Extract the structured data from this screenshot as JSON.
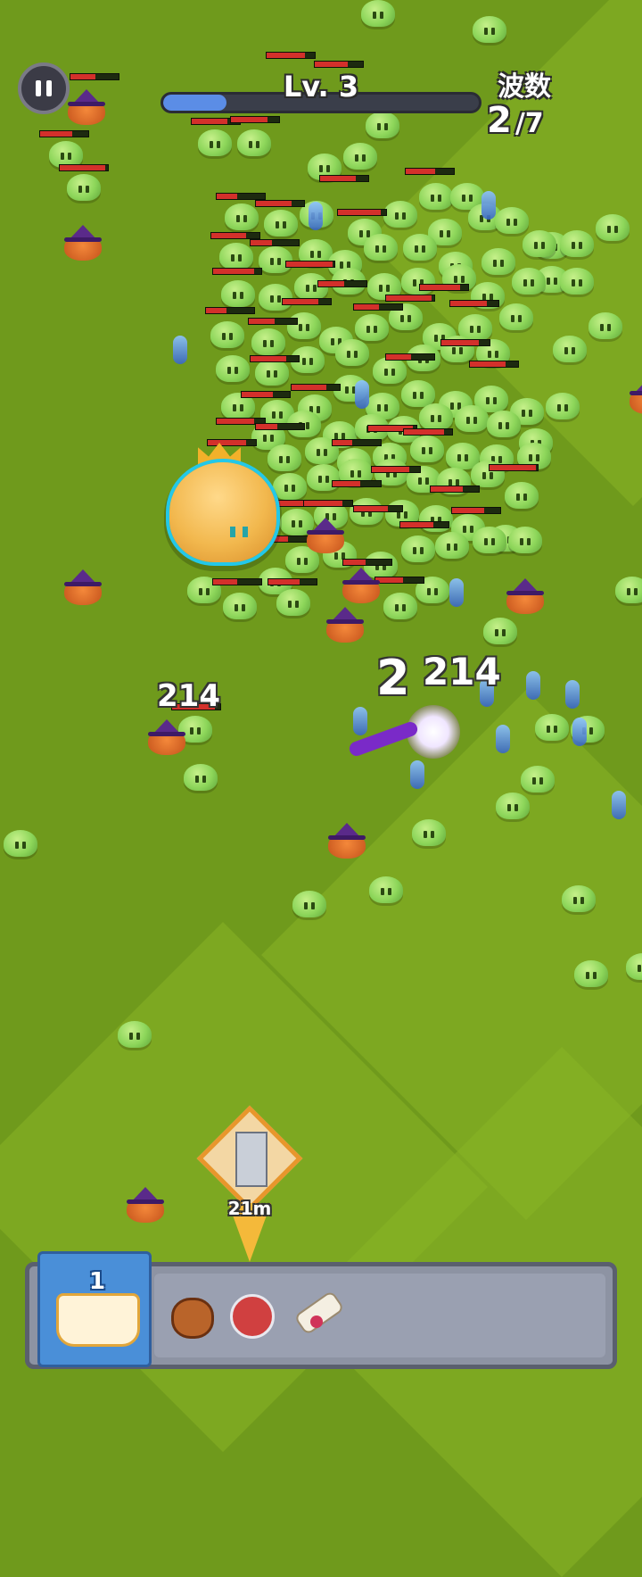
{
  "hud": {
    "pause_icon": "pause-icon",
    "level_label": "Lv. 3",
    "xp_progress": 0.2,
    "wave_label": "波数",
    "wave_current": "2",
    "wave_total": "/7"
  },
  "combat": {
    "damage_numbers": [
      "214",
      "2",
      "214"
    ]
  },
  "marker": {
    "icon": "tower-icon",
    "distance": "21m"
  },
  "bottom_bar": {
    "spellbook_count": "1",
    "items": [
      "coin-bag-icon",
      "potion-icon",
      "scroll-icon"
    ]
  },
  "colors": {
    "grass": "#6f9a1c",
    "xp_fill": "#5b8de6",
    "boss_outline": "#23c8e8",
    "hp_bar": "#d3302b"
  }
}
